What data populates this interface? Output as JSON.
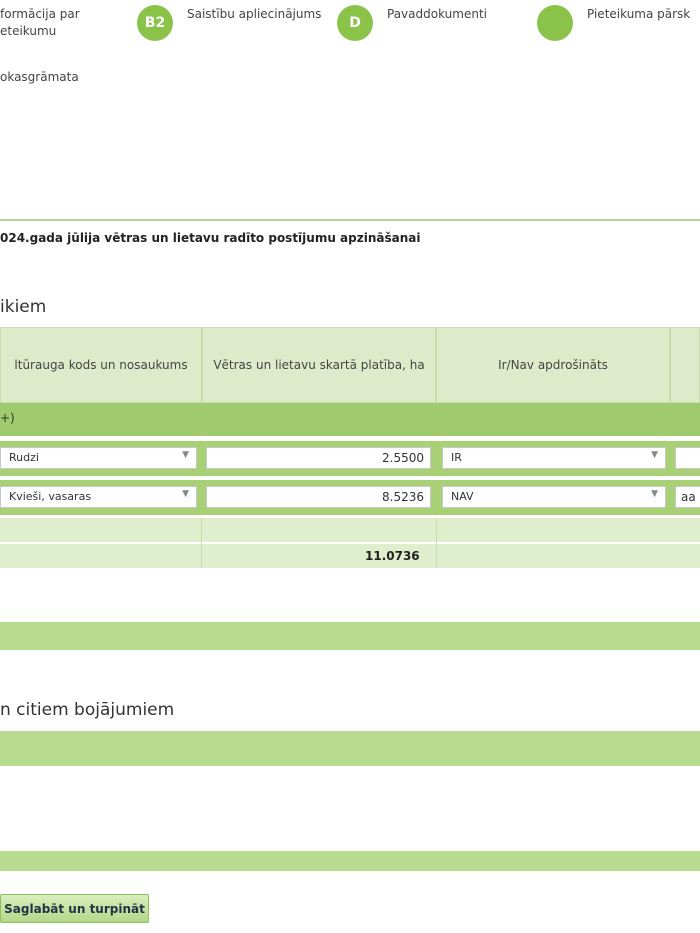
{
  "stepper": {
    "steps": [
      {
        "badge": "",
        "label_line1": "formācija par",
        "label_line2": "eteikumu"
      },
      {
        "badge": "B2",
        "label_line1": "Saistību apliecinājums",
        "label_line2": ""
      },
      {
        "badge": "D",
        "label_line1": "Pavaddokumenti",
        "label_line2": ""
      },
      {
        "badge": "",
        "label_line1": "Pieteikuma pārsk",
        "label_line2": ""
      }
    ],
    "extra_step": "okasgrāmata"
  },
  "page_heading": "024.gada jūlija vētras un lietavu radīto postījumu apzināšanai",
  "section1_title": "ikiem",
  "table": {
    "headers": [
      "ltūrauga kods un nosaukums",
      "Vētras un lietavu skartā platība, ha",
      "Ir/Nav apdrošināts"
    ],
    "group_label": "+)",
    "rows": [
      {
        "crop": "Rudzi",
        "area": "2.5500",
        "insured": "IR",
        "extra": ""
      },
      {
        "crop": "Kvieši, vasaras",
        "area": "8.5236",
        "insured": "NAV",
        "extra": "aa"
      }
    ],
    "total": "11.0736"
  },
  "section2_title": "n citiem bojājumiem",
  "save_button": "Saglabāt un turpināt",
  "colors": {
    "accent": "#8bc34a",
    "header_bg": "#deebcb",
    "row_bg": "#a8d176",
    "bar_bg": "#b7dc8f"
  }
}
